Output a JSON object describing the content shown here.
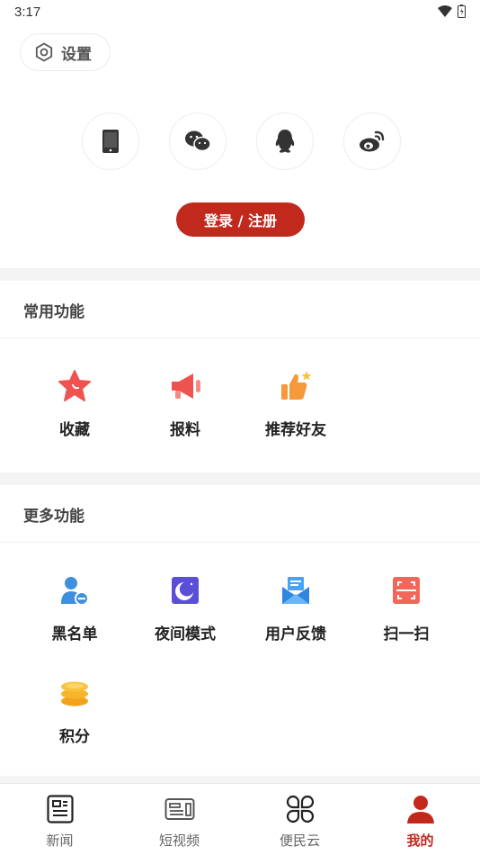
{
  "status_bar": {
    "time": "3:17"
  },
  "header": {
    "settings_label": "设置"
  },
  "login": {
    "options": [
      {
        "name": "phone",
        "icon": "phone-icon"
      },
      {
        "name": "wechat",
        "icon": "wechat-icon"
      },
      {
        "name": "qq",
        "icon": "qq-icon"
      },
      {
        "name": "weibo",
        "icon": "weibo-icon"
      }
    ],
    "button_label": "登录 / 注册"
  },
  "common_section": {
    "title": "常用功能",
    "items": [
      {
        "label": "收藏",
        "icon": "star-icon"
      },
      {
        "label": "报料",
        "icon": "megaphone-icon"
      },
      {
        "label": "推荐好友",
        "icon": "thumbs-up-icon"
      }
    ]
  },
  "more_section": {
    "title": "更多功能",
    "items": [
      {
        "label": "黑名单",
        "icon": "blacklist-user-icon"
      },
      {
        "label": "夜间模式",
        "icon": "night-mode-icon"
      },
      {
        "label": "用户反馈",
        "icon": "feedback-mail-icon"
      },
      {
        "label": "扫一扫",
        "icon": "scan-icon"
      },
      {
        "label": "积分",
        "icon": "points-coins-icon"
      }
    ]
  },
  "tabbar": {
    "tabs": [
      {
        "label": "新闻",
        "icon": "news-icon",
        "active": false
      },
      {
        "label": "短视频",
        "icon": "short-video-icon",
        "active": false
      },
      {
        "label": "便民云",
        "icon": "services-icon",
        "active": false
      },
      {
        "label": "我的",
        "icon": "profile-icon",
        "active": true
      }
    ]
  },
  "colors": {
    "accent": "#c1291d",
    "background": "#ffffff",
    "separator": "#f4f4f4"
  }
}
